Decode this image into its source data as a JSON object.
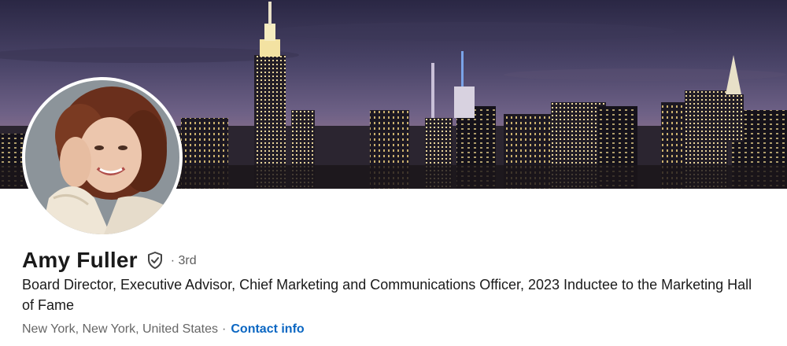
{
  "profile": {
    "name": "Amy Fuller",
    "degree": "· 3rd",
    "headline": "Board Director, Executive Advisor, Chief Marketing and Communications Officer, 2023 Inductee to the Marketing Hall of Fame",
    "location": "New York, New York, United States",
    "separator": "·",
    "contact_label": "Contact info"
  },
  "colors": {
    "link": "#0a66c2",
    "name_text": "#1a1a1a",
    "secondary_text": "#666666"
  },
  "icons": {
    "verification": "shield-check-icon"
  }
}
